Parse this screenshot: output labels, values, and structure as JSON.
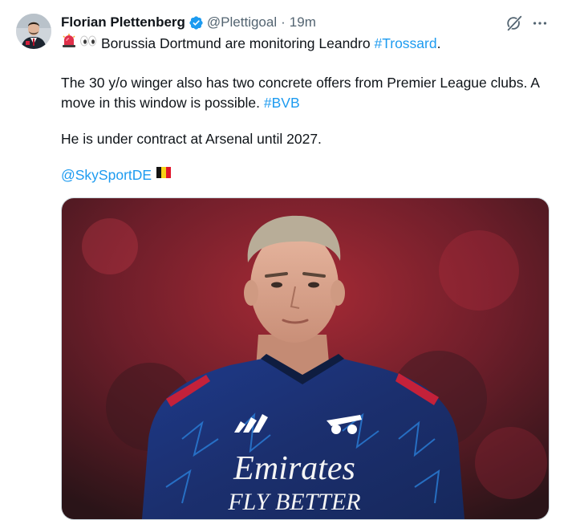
{
  "author": {
    "name": "Florian Plettenberg",
    "handle": "@Plettigoal",
    "separator": "·",
    "time": "19m"
  },
  "tweet": {
    "line1_text": "Borussia Dortmund are monitoring Leandro ",
    "line1_hashtag": "#Trossard",
    "line1_end": ".",
    "para2_text": "The 30 y/o winger also has two concrete offers from Premier League clubs. A move in this window is possible. ",
    "para2_hashtag": "#BVB",
    "para3_text": "He is under contract at Arsenal until 2027.",
    "mention": "@SkySportDE"
  },
  "media": {
    "sponsor_line1": "Emirates",
    "sponsor_line2": "FLY BETTER"
  },
  "colors": {
    "link": "#1d9bf0",
    "verified": "#1d9bf0",
    "text": "#0f1419",
    "secondary": "#536471"
  },
  "icons": {
    "verified": "verified-badge-icon",
    "grok": "grok-icon",
    "more": "more-icon",
    "siren": "siren-emoji",
    "eyes": "eyes-emoji",
    "flag": "belgium-flag-emoji"
  }
}
